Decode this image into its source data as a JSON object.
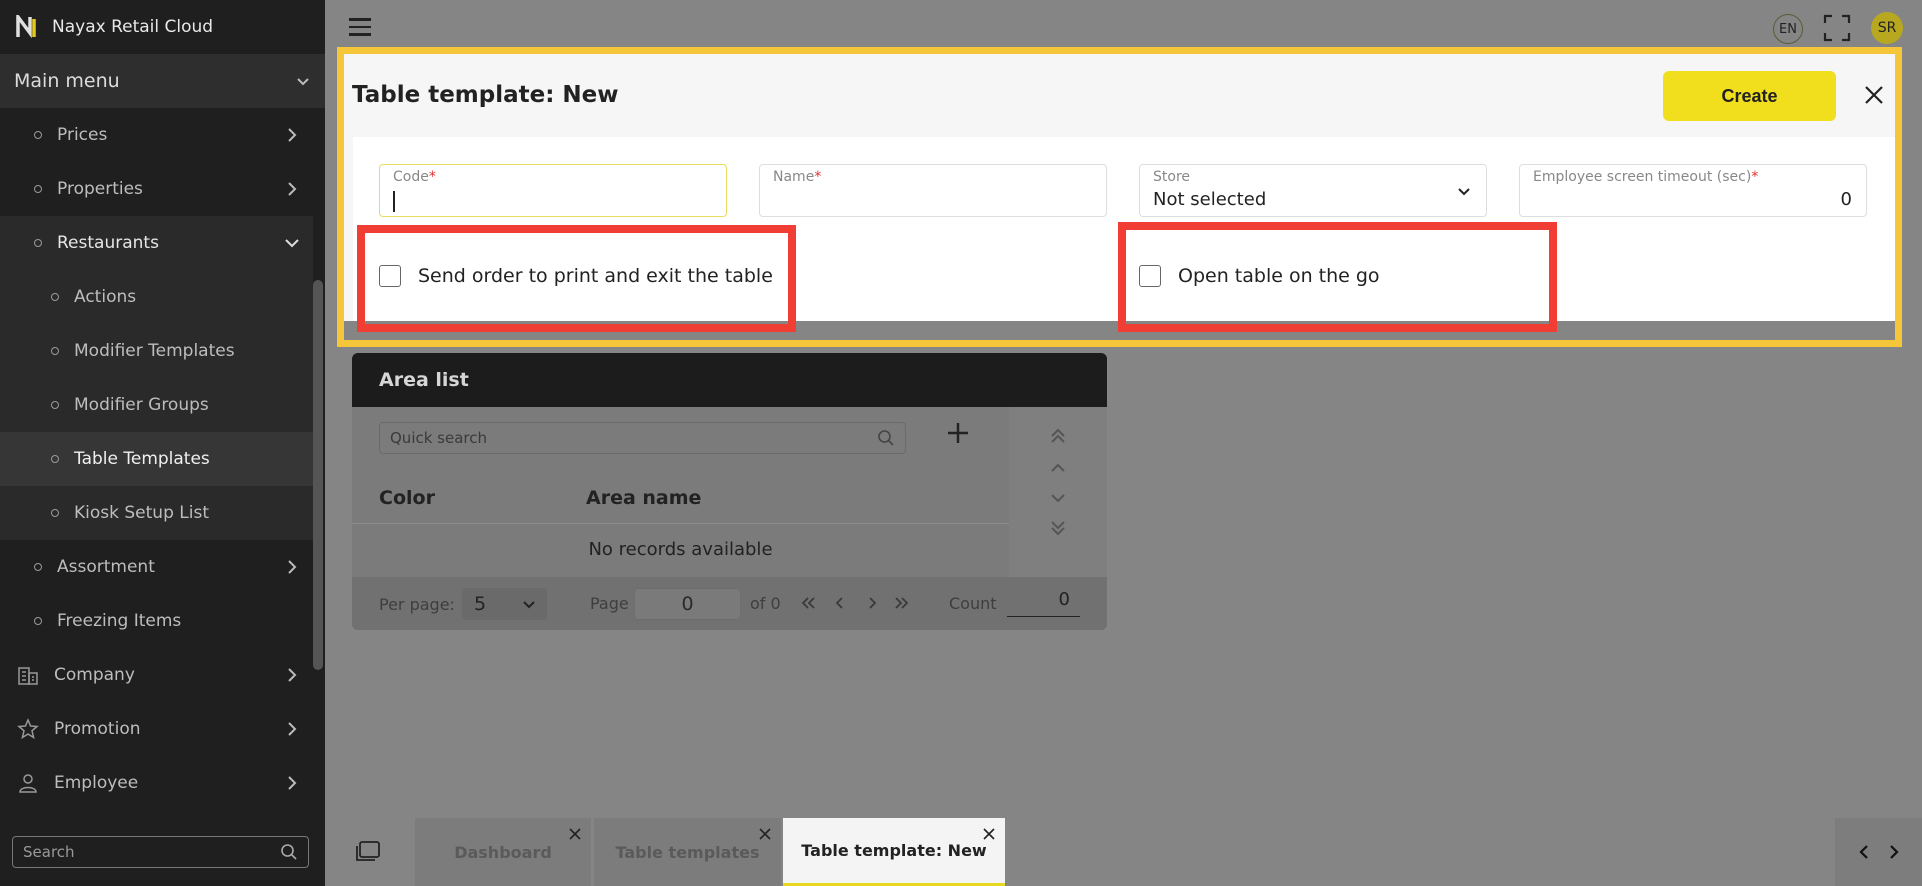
{
  "sidebar": {
    "brand": "Nayax Retail Cloud",
    "main_menu": "Main menu",
    "items": [
      {
        "label": "Prices"
      },
      {
        "label": "Properties"
      },
      {
        "label": "Restaurants"
      },
      {
        "label": "Actions"
      },
      {
        "label": "Modifier Templates"
      },
      {
        "label": "Modifier Groups"
      },
      {
        "label": "Table Templates"
      },
      {
        "label": "Kiosk Setup List"
      },
      {
        "label": "Assortment"
      },
      {
        "label": "Freezing Items"
      },
      {
        "label": "Company"
      },
      {
        "label": "Promotion"
      },
      {
        "label": "Employee"
      }
    ],
    "search_placeholder": "Search"
  },
  "topbar": {
    "language": "EN",
    "user_initials": "SR"
  },
  "dialog": {
    "title": "Table template: New",
    "create_label": "Create",
    "fields": {
      "code": {
        "label": "Code",
        "value": ""
      },
      "name": {
        "label": "Name",
        "value": ""
      },
      "store": {
        "label": "Store",
        "value": "Not selected"
      },
      "timeout": {
        "label": "Employee screen timeout (sec)",
        "value": "0"
      }
    },
    "required_mark": "*",
    "checkboxes": {
      "send_order": "Send order to print and exit the table",
      "open_on_go": "Open table on the go"
    }
  },
  "area_list": {
    "title": "Area list",
    "search_placeholder": "Quick search",
    "columns": {
      "color": "Color",
      "area_name": "Area name"
    },
    "empty": "No records available",
    "footer": {
      "per_page_label": "Per page:",
      "per_page_value": "5",
      "page_label": "Page",
      "page_value": "0",
      "of_label": "of 0",
      "count_label": "Count",
      "count_value": "0"
    }
  },
  "tabs": [
    {
      "label": "Dashboard"
    },
    {
      "label": "Table templates"
    },
    {
      "label": "Table template: New"
    }
  ],
  "colors": {
    "accent": "#f1de1c",
    "highlight_frame": "#f6c63a",
    "annotation_red": "#f13e35",
    "required": "#e3312f"
  }
}
